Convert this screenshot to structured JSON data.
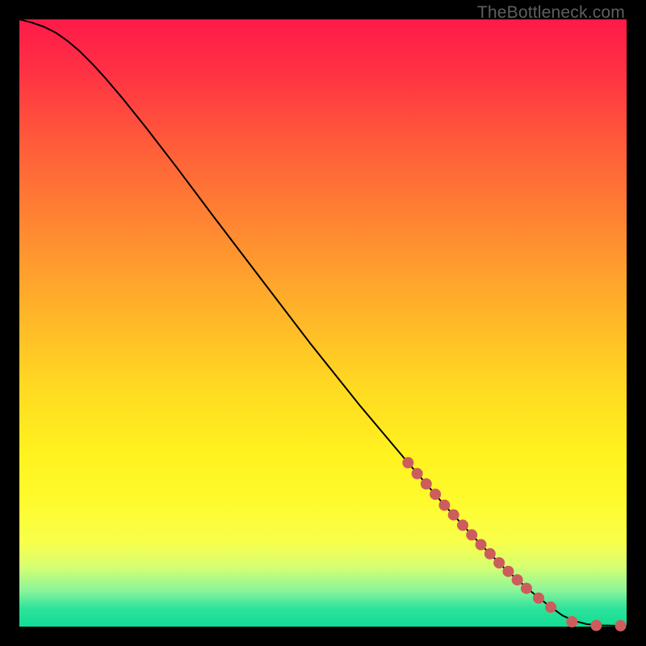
{
  "watermark": "TheBottleneck.com",
  "chart_data": {
    "type": "line",
    "title": "",
    "xlabel": "",
    "ylabel": "",
    "xlim": [
      0,
      100
    ],
    "ylim": [
      0,
      100
    ],
    "grid": false,
    "legend": false,
    "curve_points": [
      {
        "x": 0.0,
        "y": 100.0
      },
      {
        "x": 2.0,
        "y": 99.5
      },
      {
        "x": 4.0,
        "y": 98.8
      },
      {
        "x": 6.0,
        "y": 97.8
      },
      {
        "x": 8.0,
        "y": 96.4
      },
      {
        "x": 10.0,
        "y": 94.7
      },
      {
        "x": 12.0,
        "y": 92.7
      },
      {
        "x": 14.0,
        "y": 90.5
      },
      {
        "x": 17.0,
        "y": 87.0
      },
      {
        "x": 21.0,
        "y": 82.0
      },
      {
        "x": 26.0,
        "y": 75.5
      },
      {
        "x": 32.0,
        "y": 67.5
      },
      {
        "x": 40.0,
        "y": 57.0
      },
      {
        "x": 48.0,
        "y": 46.5
      },
      {
        "x": 56.0,
        "y": 36.5
      },
      {
        "x": 64.0,
        "y": 27.0
      },
      {
        "x": 70.0,
        "y": 20.0
      },
      {
        "x": 76.0,
        "y": 13.5
      },
      {
        "x": 80.0,
        "y": 9.5
      },
      {
        "x": 84.0,
        "y": 6.0
      },
      {
        "x": 87.0,
        "y": 3.6
      },
      {
        "x": 89.5,
        "y": 1.8
      },
      {
        "x": 91.5,
        "y": 0.9
      },
      {
        "x": 93.5,
        "y": 0.4
      },
      {
        "x": 96.0,
        "y": 0.2
      },
      {
        "x": 98.0,
        "y": 0.15
      },
      {
        "x": 100.0,
        "y": 0.15
      }
    ],
    "markers": [
      {
        "x": 64.0,
        "y": 27.0
      },
      {
        "x": 65.5,
        "y": 25.2
      },
      {
        "x": 67.0,
        "y": 23.5
      },
      {
        "x": 68.5,
        "y": 21.8
      },
      {
        "x": 70.0,
        "y": 20.0
      },
      {
        "x": 71.5,
        "y": 18.4
      },
      {
        "x": 73.0,
        "y": 16.7
      },
      {
        "x": 74.5,
        "y": 15.1
      },
      {
        "x": 76.0,
        "y": 13.5
      },
      {
        "x": 77.5,
        "y": 12.0
      },
      {
        "x": 79.0,
        "y": 10.5
      },
      {
        "x": 80.5,
        "y": 9.1
      },
      {
        "x": 82.0,
        "y": 7.7
      },
      {
        "x": 83.5,
        "y": 6.3
      },
      {
        "x": 85.5,
        "y": 4.7
      },
      {
        "x": 87.5,
        "y": 3.2
      },
      {
        "x": 91.0,
        "y": 0.8
      },
      {
        "x": 95.0,
        "y": 0.2
      },
      {
        "x": 99.0,
        "y": 0.15
      }
    ]
  }
}
